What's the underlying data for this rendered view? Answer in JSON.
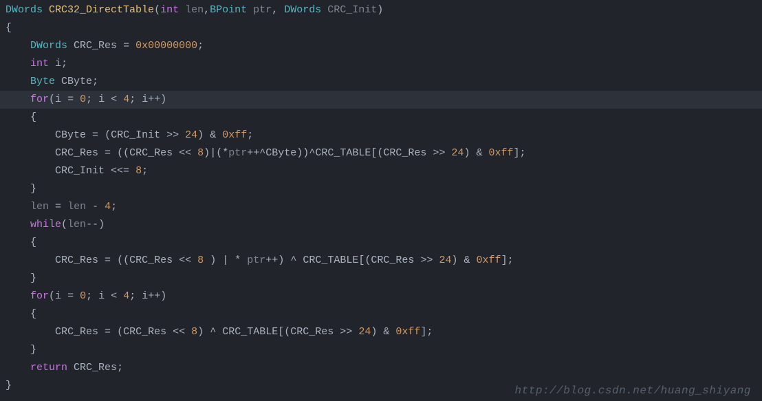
{
  "watermark": "http://blog.csdn.net/huang_shiyang",
  "code": {
    "highlight_line": 6,
    "lines": [
      {
        "indent": 0,
        "tokens": [
          {
            "t": "type",
            "v": "DWords"
          },
          {
            "t": "sp",
            "v": " "
          },
          {
            "t": "func",
            "v": "CRC32_DirectTable"
          },
          {
            "t": "punc",
            "v": "("
          },
          {
            "t": "int",
            "v": "int"
          },
          {
            "t": "sp",
            "v": " "
          },
          {
            "t": "param",
            "v": "len"
          },
          {
            "t": "punc",
            "v": ","
          },
          {
            "t": "type",
            "v": "BPoint"
          },
          {
            "t": "sp",
            "v": " "
          },
          {
            "t": "param",
            "v": "ptr"
          },
          {
            "t": "punc",
            "v": ", "
          },
          {
            "t": "type",
            "v": "DWords"
          },
          {
            "t": "sp",
            "v": " "
          },
          {
            "t": "param",
            "v": "CRC_Init"
          },
          {
            "t": "punc",
            "v": ")"
          }
        ]
      },
      {
        "indent": 0,
        "tokens": [
          {
            "t": "brace",
            "v": "{"
          }
        ]
      },
      {
        "indent": 1,
        "tokens": [
          {
            "t": "type",
            "v": "DWords"
          },
          {
            "t": "sp",
            "v": " "
          },
          {
            "t": "ident",
            "v": "CRC_Res"
          },
          {
            "t": "sp",
            "v": " "
          },
          {
            "t": "op",
            "v": "="
          },
          {
            "t": "sp",
            "v": " "
          },
          {
            "t": "num",
            "v": "0x00000000"
          },
          {
            "t": "punc",
            "v": ";"
          }
        ]
      },
      {
        "indent": 1,
        "tokens": [
          {
            "t": "int",
            "v": "int"
          },
          {
            "t": "sp",
            "v": " "
          },
          {
            "t": "ident",
            "v": "i"
          },
          {
            "t": "punc",
            "v": ";"
          }
        ]
      },
      {
        "indent": 1,
        "tokens": [
          {
            "t": "type",
            "v": "Byte"
          },
          {
            "t": "sp",
            "v": " "
          },
          {
            "t": "ident",
            "v": "CByte"
          },
          {
            "t": "punc",
            "v": ";"
          }
        ]
      },
      {
        "indent": 1,
        "tokens": [
          {
            "t": "kw",
            "v": "for"
          },
          {
            "t": "punc",
            "v": "("
          },
          {
            "t": "ident",
            "v": "i"
          },
          {
            "t": "sp",
            "v": " "
          },
          {
            "t": "op",
            "v": "="
          },
          {
            "t": "sp",
            "v": " "
          },
          {
            "t": "num",
            "v": "0"
          },
          {
            "t": "punc",
            "v": "; "
          },
          {
            "t": "ident",
            "v": "i"
          },
          {
            "t": "sp",
            "v": " "
          },
          {
            "t": "op",
            "v": "<"
          },
          {
            "t": "sp",
            "v": " "
          },
          {
            "t": "num",
            "v": "4"
          },
          {
            "t": "punc",
            "v": "; "
          },
          {
            "t": "ident",
            "v": "i"
          },
          {
            "t": "op",
            "v": "++"
          },
          {
            "t": "punc",
            "v": ")"
          }
        ]
      },
      {
        "indent": 1,
        "tokens": [
          {
            "t": "brace",
            "v": "{"
          }
        ]
      },
      {
        "indent": 2,
        "tokens": [
          {
            "t": "ident",
            "v": "CByte"
          },
          {
            "t": "sp",
            "v": " "
          },
          {
            "t": "op",
            "v": "="
          },
          {
            "t": "sp",
            "v": " "
          },
          {
            "t": "punc",
            "v": "("
          },
          {
            "t": "ident",
            "v": "CRC_Init"
          },
          {
            "t": "sp",
            "v": " "
          },
          {
            "t": "op",
            "v": ">>"
          },
          {
            "t": "sp",
            "v": " "
          },
          {
            "t": "num",
            "v": "24"
          },
          {
            "t": "punc",
            "v": ")"
          },
          {
            "t": "sp",
            "v": " "
          },
          {
            "t": "op",
            "v": "&"
          },
          {
            "t": "sp",
            "v": " "
          },
          {
            "t": "num",
            "v": "0xff"
          },
          {
            "t": "punc",
            "v": ";"
          }
        ]
      },
      {
        "indent": 2,
        "tokens": [
          {
            "t": "ident",
            "v": "CRC_Res"
          },
          {
            "t": "sp",
            "v": " "
          },
          {
            "t": "op",
            "v": "="
          },
          {
            "t": "sp",
            "v": " "
          },
          {
            "t": "punc",
            "v": "(("
          },
          {
            "t": "ident",
            "v": "CRC_Res"
          },
          {
            "t": "sp",
            "v": " "
          },
          {
            "t": "op",
            "v": "<<"
          },
          {
            "t": "sp",
            "v": " "
          },
          {
            "t": "num",
            "v": "8"
          },
          {
            "t": "punc",
            "v": ")"
          },
          {
            "t": "op",
            "v": "|"
          },
          {
            "t": "punc",
            "v": "("
          },
          {
            "t": "op",
            "v": "*"
          },
          {
            "t": "param",
            "v": "ptr"
          },
          {
            "t": "op",
            "v": "++"
          },
          {
            "t": "op",
            "v": "^"
          },
          {
            "t": "ident",
            "v": "CByte"
          },
          {
            "t": "punc",
            "v": "))"
          },
          {
            "t": "op",
            "v": "^"
          },
          {
            "t": "ident",
            "v": "CRC_TABLE"
          },
          {
            "t": "punc",
            "v": "[("
          },
          {
            "t": "ident",
            "v": "CRC_Res"
          },
          {
            "t": "sp",
            "v": " "
          },
          {
            "t": "op",
            "v": ">>"
          },
          {
            "t": "sp",
            "v": " "
          },
          {
            "t": "num",
            "v": "24"
          },
          {
            "t": "punc",
            "v": ")"
          },
          {
            "t": "sp",
            "v": " "
          },
          {
            "t": "op",
            "v": "&"
          },
          {
            "t": "sp",
            "v": " "
          },
          {
            "t": "num",
            "v": "0xff"
          },
          {
            "t": "punc",
            "v": "];"
          }
        ]
      },
      {
        "indent": 2,
        "tokens": [
          {
            "t": "ident",
            "v": "CRC_Init"
          },
          {
            "t": "sp",
            "v": " "
          },
          {
            "t": "op",
            "v": "<<="
          },
          {
            "t": "sp",
            "v": " "
          },
          {
            "t": "num",
            "v": "8"
          },
          {
            "t": "punc",
            "v": ";"
          }
        ]
      },
      {
        "indent": 1,
        "tokens": [
          {
            "t": "brace",
            "v": "}"
          }
        ]
      },
      {
        "indent": 1,
        "tokens": [
          {
            "t": "param",
            "v": "len"
          },
          {
            "t": "sp",
            "v": " "
          },
          {
            "t": "op",
            "v": "="
          },
          {
            "t": "sp",
            "v": " "
          },
          {
            "t": "param",
            "v": "len"
          },
          {
            "t": "sp",
            "v": " "
          },
          {
            "t": "op",
            "v": "-"
          },
          {
            "t": "sp",
            "v": " "
          },
          {
            "t": "num",
            "v": "4"
          },
          {
            "t": "punc",
            "v": ";"
          }
        ]
      },
      {
        "indent": 1,
        "tokens": [
          {
            "t": "kw",
            "v": "while"
          },
          {
            "t": "punc",
            "v": "("
          },
          {
            "t": "param",
            "v": "len"
          },
          {
            "t": "op",
            "v": "--"
          },
          {
            "t": "punc",
            "v": ")"
          }
        ]
      },
      {
        "indent": 1,
        "tokens": [
          {
            "t": "brace",
            "v": "{"
          }
        ]
      },
      {
        "indent": 2,
        "tokens": [
          {
            "t": "ident",
            "v": "CRC_Res"
          },
          {
            "t": "sp",
            "v": " "
          },
          {
            "t": "op",
            "v": "="
          },
          {
            "t": "sp",
            "v": " "
          },
          {
            "t": "punc",
            "v": "(("
          },
          {
            "t": "ident",
            "v": "CRC_Res"
          },
          {
            "t": "sp",
            "v": " "
          },
          {
            "t": "op",
            "v": "<<"
          },
          {
            "t": "sp",
            "v": " "
          },
          {
            "t": "num",
            "v": "8"
          },
          {
            "t": "sp",
            "v": " "
          },
          {
            "t": "punc",
            "v": ")"
          },
          {
            "t": "sp",
            "v": " "
          },
          {
            "t": "op",
            "v": "|"
          },
          {
            "t": "sp",
            "v": " "
          },
          {
            "t": "op",
            "v": "*"
          },
          {
            "t": "sp",
            "v": " "
          },
          {
            "t": "param",
            "v": "ptr"
          },
          {
            "t": "op",
            "v": "++"
          },
          {
            "t": "punc",
            "v": ")"
          },
          {
            "t": "sp",
            "v": " "
          },
          {
            "t": "op",
            "v": "^"
          },
          {
            "t": "sp",
            "v": " "
          },
          {
            "t": "ident",
            "v": "CRC_TABLE"
          },
          {
            "t": "punc",
            "v": "[("
          },
          {
            "t": "ident",
            "v": "CRC_Res"
          },
          {
            "t": "sp",
            "v": " "
          },
          {
            "t": "op",
            "v": ">>"
          },
          {
            "t": "sp",
            "v": " "
          },
          {
            "t": "num",
            "v": "24"
          },
          {
            "t": "punc",
            "v": ")"
          },
          {
            "t": "sp",
            "v": " "
          },
          {
            "t": "op",
            "v": "&"
          },
          {
            "t": "sp",
            "v": " "
          },
          {
            "t": "num",
            "v": "0xff"
          },
          {
            "t": "punc",
            "v": "];"
          }
        ]
      },
      {
        "indent": 1,
        "tokens": [
          {
            "t": "brace",
            "v": "}"
          }
        ]
      },
      {
        "indent": 1,
        "tokens": [
          {
            "t": "kw",
            "v": "for"
          },
          {
            "t": "punc",
            "v": "("
          },
          {
            "t": "ident",
            "v": "i"
          },
          {
            "t": "sp",
            "v": " "
          },
          {
            "t": "op",
            "v": "="
          },
          {
            "t": "sp",
            "v": " "
          },
          {
            "t": "num",
            "v": "0"
          },
          {
            "t": "punc",
            "v": "; "
          },
          {
            "t": "ident",
            "v": "i"
          },
          {
            "t": "sp",
            "v": " "
          },
          {
            "t": "op",
            "v": "<"
          },
          {
            "t": "sp",
            "v": " "
          },
          {
            "t": "num",
            "v": "4"
          },
          {
            "t": "punc",
            "v": "; "
          },
          {
            "t": "ident",
            "v": "i"
          },
          {
            "t": "op",
            "v": "++"
          },
          {
            "t": "punc",
            "v": ")"
          }
        ]
      },
      {
        "indent": 1,
        "tokens": [
          {
            "t": "brace",
            "v": "{"
          }
        ]
      },
      {
        "indent": 2,
        "tokens": [
          {
            "t": "ident",
            "v": "CRC_Res"
          },
          {
            "t": "sp",
            "v": " "
          },
          {
            "t": "op",
            "v": "="
          },
          {
            "t": "sp",
            "v": " "
          },
          {
            "t": "punc",
            "v": "("
          },
          {
            "t": "ident",
            "v": "CRC_Res"
          },
          {
            "t": "sp",
            "v": " "
          },
          {
            "t": "op",
            "v": "<<"
          },
          {
            "t": "sp",
            "v": " "
          },
          {
            "t": "num",
            "v": "8"
          },
          {
            "t": "punc",
            "v": ")"
          },
          {
            "t": "sp",
            "v": " "
          },
          {
            "t": "op",
            "v": "^"
          },
          {
            "t": "sp",
            "v": " "
          },
          {
            "t": "ident",
            "v": "CRC_TABLE"
          },
          {
            "t": "punc",
            "v": "[("
          },
          {
            "t": "ident",
            "v": "CRC_Res"
          },
          {
            "t": "sp",
            "v": " "
          },
          {
            "t": "op",
            "v": ">>"
          },
          {
            "t": "sp",
            "v": " "
          },
          {
            "t": "num",
            "v": "24"
          },
          {
            "t": "punc",
            "v": ")"
          },
          {
            "t": "sp",
            "v": " "
          },
          {
            "t": "op",
            "v": "&"
          },
          {
            "t": "sp",
            "v": " "
          },
          {
            "t": "num",
            "v": "0xff"
          },
          {
            "t": "punc",
            "v": "];"
          }
        ]
      },
      {
        "indent": 1,
        "tokens": [
          {
            "t": "brace",
            "v": "}"
          }
        ]
      },
      {
        "indent": 1,
        "tokens": [
          {
            "t": "kw",
            "v": "return"
          },
          {
            "t": "sp",
            "v": " "
          },
          {
            "t": "ident",
            "v": "CRC_Res"
          },
          {
            "t": "punc",
            "v": ";"
          }
        ]
      },
      {
        "indent": 0,
        "tokens": [
          {
            "t": "brace",
            "v": "}"
          }
        ]
      }
    ]
  }
}
